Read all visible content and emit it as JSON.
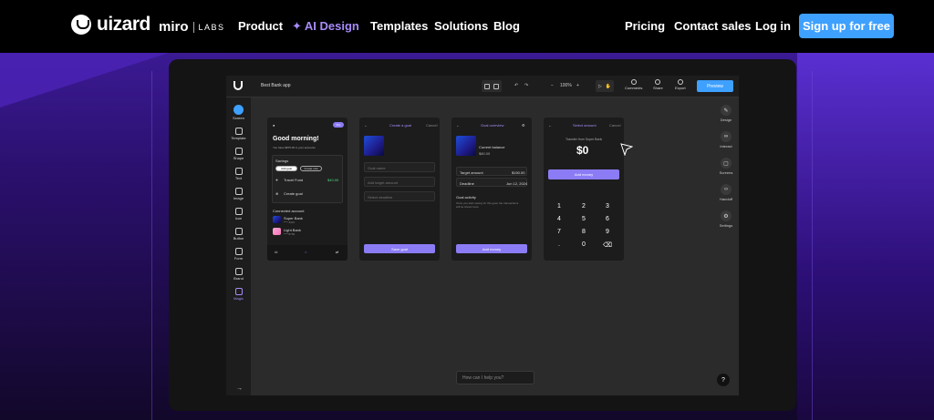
{
  "nav": {
    "logo_text": "uizard",
    "partner_name": "miro",
    "partner_labs": "LABS",
    "links": [
      "Product",
      "AI Design",
      "Templates",
      "Solutions",
      "Blog"
    ],
    "right_links": [
      "Pricing",
      "Contact sales",
      "Log in"
    ],
    "cta": "Sign up for free",
    "accent_color": "#3ea0ff",
    "ai_color": "#a78bfa"
  },
  "app": {
    "project_name": "Best Bank app",
    "zoom": "100%",
    "actions": [
      "Comments",
      "Share",
      "Export"
    ],
    "preview_label": "Preview",
    "left_tools": [
      "Screen",
      "Template",
      "Shape",
      "Text",
      "Image",
      "Icon",
      "Button",
      "Form",
      "Brand",
      "Magic"
    ],
    "right_tools": [
      "Design",
      "Interact",
      "Screens",
      "Handoff",
      "Settings"
    ],
    "chat_placeholder": "How can I help you?",
    "help_label": "?"
  },
  "screens": {
    "s1": {
      "greeting": "Good morning!",
      "subtitle": "You have $875.00 in your accounts",
      "badge": "Pro",
      "savings_label": "Savings",
      "pill_on": "Add goal",
      "pill_off": "Create new",
      "travel": "Travel Fund",
      "travel_value": "$40.00",
      "create_goal": "Create goal",
      "connected": "Connected account",
      "acc1": "Super Bank",
      "acc1_sub": "**** 4321",
      "acc2": "Light Bank",
      "acc2_sub": "**** 8765"
    },
    "s2": {
      "title": "Create a goal",
      "cancel": "Cancel",
      "f1": "Goal name",
      "f2": "Add target amount",
      "f3": "Select deadline",
      "button": "Save goal"
    },
    "s3": {
      "title": "Goal overview",
      "balance_label": "Current balance",
      "balance": "$80.00",
      "target_label": "Target amount",
      "target": "$150.00",
      "deadline_label": "Deadline",
      "deadline": "Jun 12, 2024",
      "activity": "Goal activity",
      "activity_sub": "Once you start saving for this goal, the transactions will be shown here",
      "button": "Add money"
    },
    "s4": {
      "title": "Select amount",
      "cancel": "Cancel",
      "from": "Transfer from Super Bank",
      "amount": "$0",
      "button": "Add money",
      "keys": [
        "1",
        "2",
        "3",
        "4",
        "5",
        "6",
        "7",
        "8",
        "9",
        ".",
        "0",
        "⌫"
      ]
    }
  }
}
